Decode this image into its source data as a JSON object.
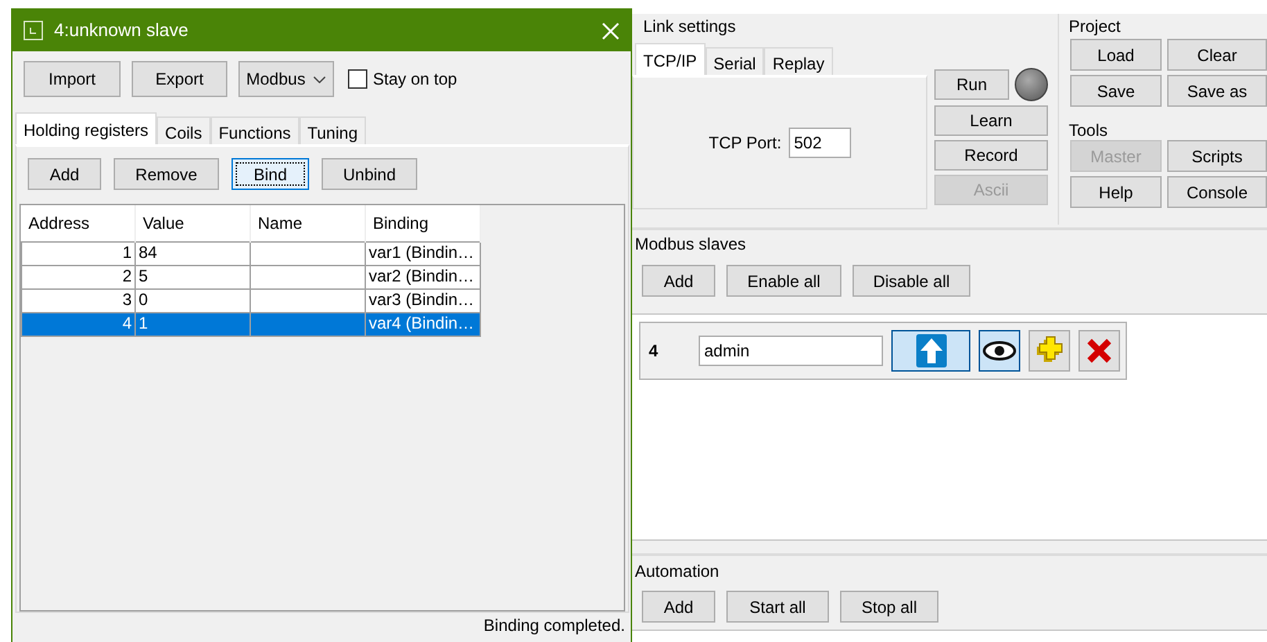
{
  "dialog": {
    "title": "4:unknown slave",
    "toolbar": [
      {
        "label": "Import"
      },
      {
        "label": "Export"
      }
    ],
    "protocol": "Modbus",
    "stay_on_top": {
      "label": "Stay on top",
      "checked": false
    },
    "tabs": [
      {
        "label": "Holding registers",
        "selected": true
      },
      {
        "label": "Coils",
        "selected": false
      },
      {
        "label": "Functions",
        "selected": false
      },
      {
        "label": "Tuning",
        "selected": false
      }
    ],
    "actions": [
      {
        "label": "Add",
        "focused": false
      },
      {
        "label": "Remove",
        "focused": false
      },
      {
        "label": "Bind",
        "focused": true
      },
      {
        "label": "Unbind",
        "focused": false
      }
    ],
    "table": {
      "columns": [
        "Address",
        "Value",
        "Name",
        "Binding"
      ],
      "rows": [
        {
          "address": "1",
          "value": "84",
          "name": "",
          "binding": "var1 (Bindin…",
          "selected": false
        },
        {
          "address": "2",
          "value": "5",
          "name": "",
          "binding": "var2 (Bindin…",
          "selected": false
        },
        {
          "address": "3",
          "value": "0",
          "name": "",
          "binding": "var3 (Bindin…",
          "selected": false
        },
        {
          "address": "4",
          "value": "1",
          "name": "",
          "binding": "var4 (Bindin…",
          "selected": true
        }
      ]
    },
    "status": "Binding completed."
  },
  "link_settings": {
    "title": "Link settings",
    "tabs": [
      {
        "label": "TCP/IP",
        "selected": true
      },
      {
        "label": "Serial",
        "selected": false
      },
      {
        "label": "Replay",
        "selected": false
      }
    ],
    "port_label": "TCP Port:",
    "port": "502",
    "buttons": [
      {
        "label": "Run",
        "disabled": false
      },
      {
        "label": "Learn",
        "disabled": false
      },
      {
        "label": "Record",
        "disabled": false
      },
      {
        "label": "Ascii",
        "disabled": true
      }
    ]
  },
  "project": {
    "title": "Project",
    "buttons": [
      {
        "label": "Load",
        "disabled": false
      },
      {
        "label": "Clear",
        "disabled": false
      },
      {
        "label": "Save",
        "disabled": false
      },
      {
        "label": "Save as",
        "disabled": false
      }
    ]
  },
  "tools": {
    "title": "Tools",
    "buttons": [
      {
        "label": "Master",
        "disabled": true
      },
      {
        "label": "Scripts",
        "disabled": false
      },
      {
        "label": "Help",
        "disabled": false
      },
      {
        "label": "Console",
        "disabled": false
      }
    ]
  },
  "modbus_slaves": {
    "title": "Modbus slaves",
    "buttons": [
      "Add",
      "Enable all",
      "Disable all"
    ],
    "slaves": [
      {
        "id": "4",
        "name": "admin",
        "upload_on": true,
        "watch_on": true
      }
    ]
  },
  "automation": {
    "title": "Automation",
    "buttons": [
      "Add",
      "Start all",
      "Stop all"
    ]
  }
}
